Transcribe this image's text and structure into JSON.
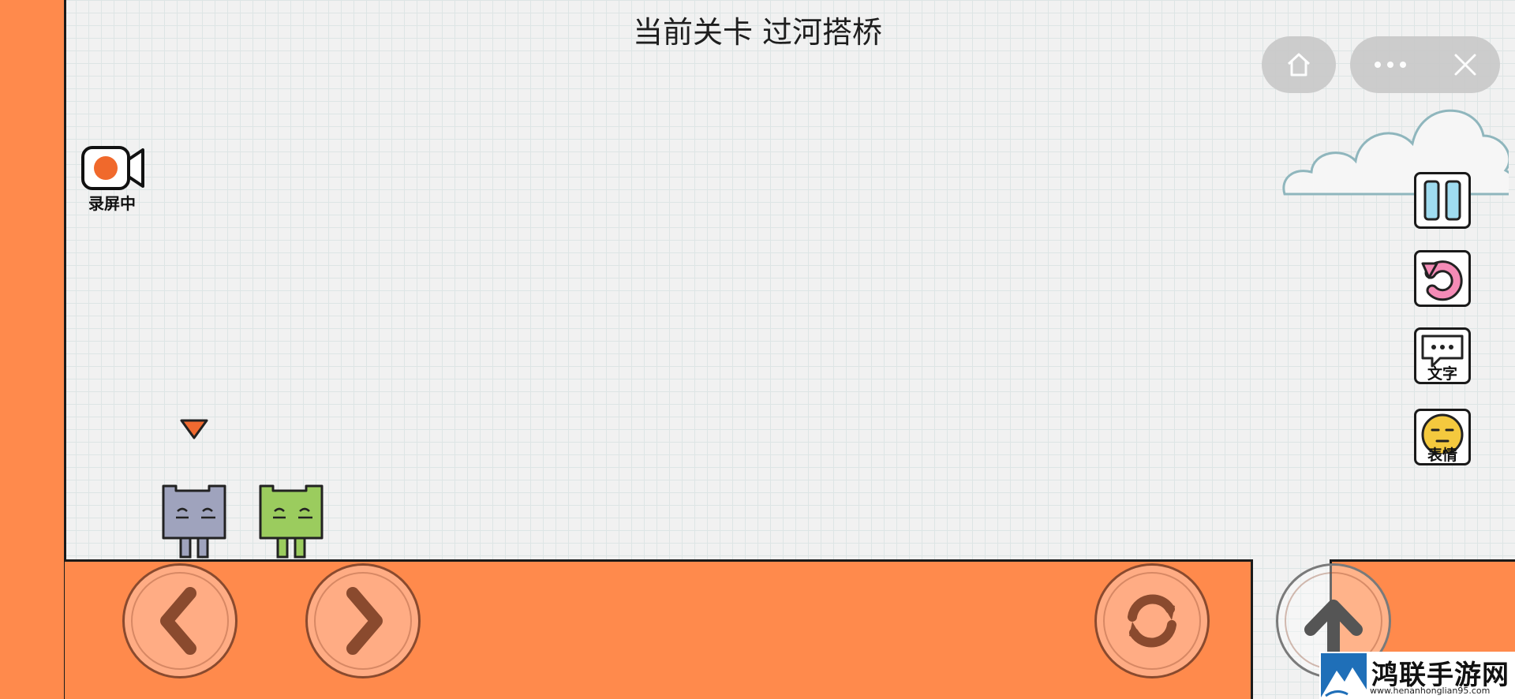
{
  "level": {
    "title": "当前关卡 过河搭桥"
  },
  "recording": {
    "label": "录屏中"
  },
  "side_buttons": {
    "text_label": "文字",
    "emoji_label": "表情"
  },
  "colors": {
    "accent": "#ff8a4c",
    "button": "#ffac84",
    "grid": "#dde5e5",
    "gray_character": "#9fa3bd",
    "green_character": "#9bcc5e"
  },
  "icons": {
    "home": "home-icon",
    "more": "more-icon",
    "close": "close-icon",
    "record": "camera-record-icon",
    "pause": "pause-icon",
    "restart": "restart-icon",
    "chat": "chat-bubble-icon",
    "emoji": "emoji-face-icon",
    "left": "arrow-left-icon",
    "right": "arrow-right-icon",
    "swap": "swap-icon",
    "jump": "arrow-up-icon"
  },
  "watermark": {
    "name": "鸿联手游网",
    "url": "www.henanhonglian95.com"
  }
}
